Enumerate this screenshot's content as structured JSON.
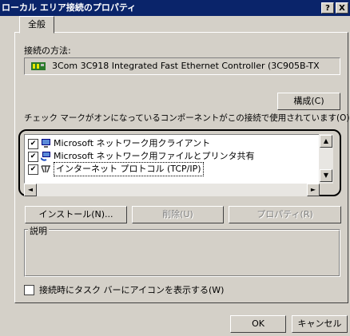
{
  "window": {
    "title": "ローカル エリア接続のプロパティ",
    "help_btn": "?",
    "close_btn": "X"
  },
  "tabs": [
    {
      "label": "全般"
    }
  ],
  "connect_using": {
    "label": "接続の方法:",
    "adapter": "3Com 3C918 Integrated Fast Ethernet Controller (3C905B-TX",
    "configure_btn": "構成(C)"
  },
  "components": {
    "label": "チェック マークがオンになっているコンポーネントがこの接続で使用されています(O):",
    "items": [
      {
        "label": "Microsoft ネットワーク用クライアント",
        "checked": "✔",
        "icon": "network-client-icon"
      },
      {
        "label": "Microsoft ネットワーク用ファイルとプリンタ共有",
        "checked": "✔",
        "icon": "file-printer-sharing-icon"
      },
      {
        "label": "インターネット プロトコル (TCP/IP)",
        "checked": "✔",
        "icon": "protocol-icon"
      }
    ],
    "scroll_up": "▲",
    "scroll_down": "▼",
    "scroll_left": "◄",
    "scroll_right": "►"
  },
  "buttons": {
    "install": "インストール(N)...",
    "uninstall": "削除(U)",
    "properties": "プロパティ(R)"
  },
  "description": {
    "label": "説明",
    "text": ""
  },
  "show_icon": {
    "label": "接続時にタスク バーにアイコンを表示する(W)",
    "checked": false
  },
  "footer": {
    "ok": "OK",
    "cancel": "キャンセル"
  },
  "colors": {
    "titlebar": "#0a246a",
    "face": "#d4d0c8",
    "highlight_ring": "#000000"
  }
}
